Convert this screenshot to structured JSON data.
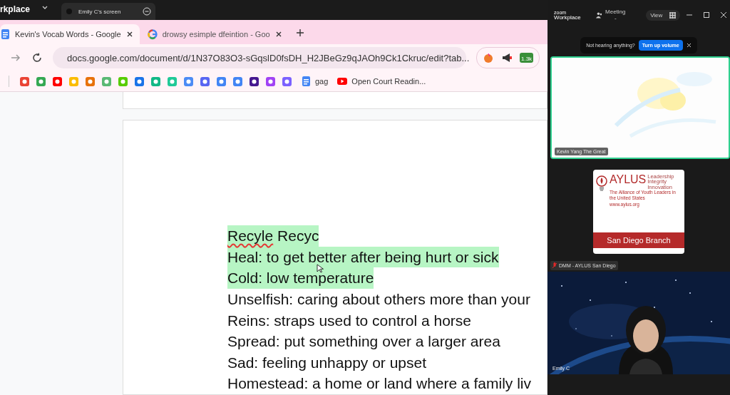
{
  "zoom_topbar": {
    "app_name": "rkplace",
    "share_tab": "Emily C's screen"
  },
  "browser": {
    "tabs": [
      {
        "title": "Kevin's Vocab Words - Google",
        "kind": "docs",
        "selected": true
      },
      {
        "title": "drowsy esimple dfeintion - Goo",
        "kind": "google",
        "selected": false
      }
    ],
    "address": "docs.google.com/document/d/1N37O83O3-sGqslD0fsDH_H2JBeGz9qJAOh9Ck1Ckruc/edit?tab...",
    "extension_badge": "1.3k",
    "bookmarks": [
      {
        "label": "gag",
        "kind": "docs"
      },
      {
        "label": "Open Court Readin...",
        "kind": "youtube"
      }
    ]
  },
  "document": {
    "lines": [
      {
        "parts": [
          {
            "text": "Recyle",
            "misspelled": true
          },
          {
            "text": " Recyc",
            "misspelled": false
          }
        ],
        "highlighted": true
      },
      {
        "parts": [
          {
            "text": "Heal: to get better after being hurt or sick",
            "misspelled": false
          }
        ],
        "highlighted": true
      },
      {
        "parts": [
          {
            "text": "Cold: low temperature",
            "misspelled": false
          }
        ],
        "highlighted": true
      },
      {
        "parts": [
          {
            "text": "Unselfish: caring about others more than your",
            "misspelled": false
          }
        ],
        "highlighted": false
      },
      {
        "parts": [
          {
            "text": "Reins: straps used to control a horse",
            "misspelled": false
          }
        ],
        "highlighted": false
      },
      {
        "parts": [
          {
            "text": "Spread: put something over a larger area",
            "misspelled": false
          }
        ],
        "highlighted": false
      },
      {
        "parts": [
          {
            "text": "Sad: feeling unhappy or upset",
            "misspelled": false
          }
        ],
        "highlighted": false
      },
      {
        "parts": [
          {
            "text": "Homestead: a home or land where a family liv",
            "misspelled": false
          }
        ],
        "highlighted": false
      }
    ]
  },
  "meeting": {
    "logo_small": "zoom",
    "logo": "Workplace",
    "meeting_menu": "Meeting -",
    "view_button": "View",
    "notice": {
      "text": "Not hearing anything?",
      "button": "Turn up volume"
    },
    "participants": [
      {
        "name": "Kevin Yang The Great",
        "kind": "video",
        "speaking": true,
        "muted": false
      },
      {
        "name": "DMM - AYLUS San Diego",
        "kind": "logo",
        "speaking": false,
        "muted": true,
        "logo": {
          "title": "AYLUS",
          "motto": "Leadership Integrity Innovation",
          "subtitle": "The Alliance of Youth Leaders in the United States",
          "url": "www.aylus.org",
          "banner": "San Diego Branch"
        }
      },
      {
        "name": "Emily C",
        "kind": "camera",
        "speaking": false,
        "muted": false
      }
    ]
  }
}
